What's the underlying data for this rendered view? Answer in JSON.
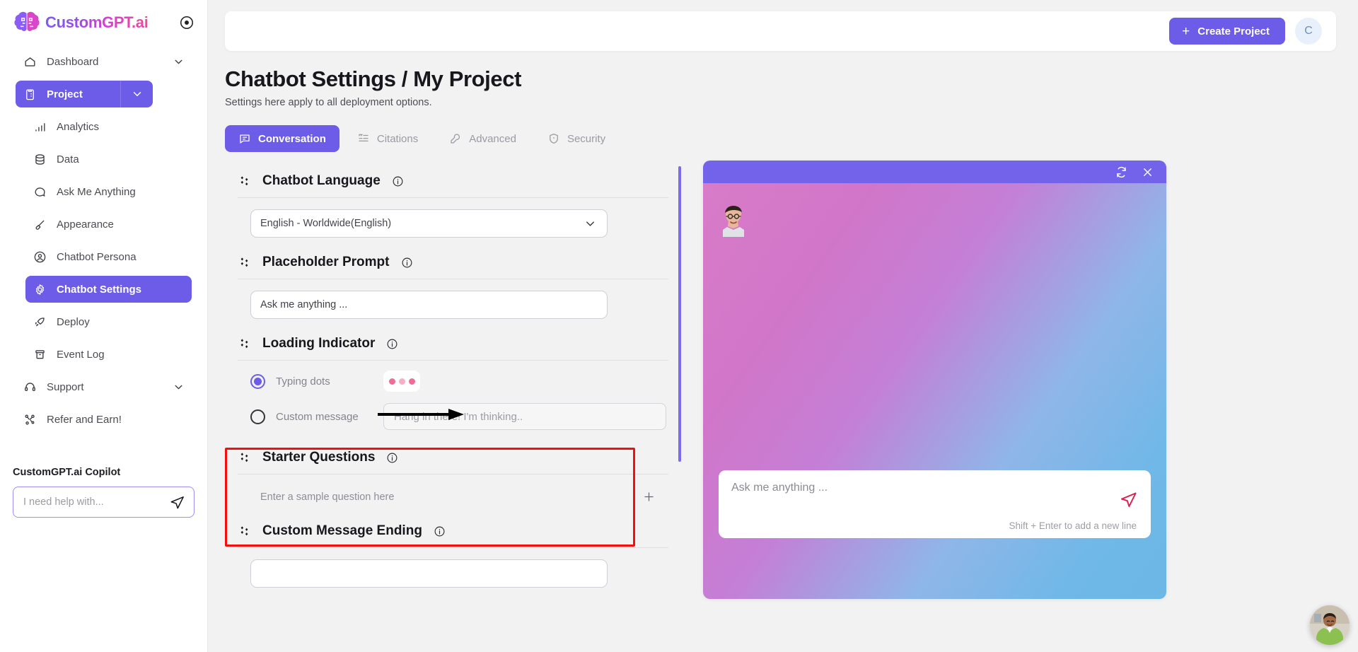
{
  "brand": {
    "name": "CustomGPT.ai",
    "target_icon": "target-icon"
  },
  "sidebar": {
    "items": [
      {
        "label": "Dashboard",
        "icon": "home-icon",
        "has_chevron": true
      },
      {
        "label": "Project",
        "icon": "clipboard-icon",
        "has_chevron": true,
        "active": true
      },
      {
        "label": "Analytics",
        "icon": "bar-chart-icon"
      },
      {
        "label": "Data",
        "icon": "database-icon"
      },
      {
        "label": "Ask Me Anything",
        "icon": "chat-bubble-icon"
      },
      {
        "label": "Appearance",
        "icon": "paintbrush-icon"
      },
      {
        "label": "Chatbot Persona",
        "icon": "user-circle-icon"
      },
      {
        "label": "Chatbot Settings",
        "icon": "gear-icon",
        "active": true
      },
      {
        "label": "Deploy",
        "icon": "rocket-icon"
      },
      {
        "label": "Event Log",
        "icon": "archive-icon"
      },
      {
        "label": "Support",
        "icon": "headset-icon",
        "has_chevron": true
      },
      {
        "label": "Refer and Earn!",
        "icon": "share-nodes-icon"
      }
    ],
    "copilot": {
      "title": "CustomGPT.ai Copilot",
      "placeholder": "I need help with...",
      "value": "",
      "send_icon": "send-icon"
    }
  },
  "topbar": {
    "create_label": "Create Project",
    "plus": "+",
    "avatar_initial": "C"
  },
  "page": {
    "title": "Chatbot Settings / My Project",
    "subtitle": "Settings here apply to all deployment options."
  },
  "tabs": [
    {
      "label": "Conversation",
      "icon": "message-square-icon",
      "active": true
    },
    {
      "label": "Citations",
      "icon": "quote-list-icon",
      "active": false
    },
    {
      "label": "Advanced",
      "icon": "wrench-icon",
      "active": false
    },
    {
      "label": "Security",
      "icon": "shield-check-icon",
      "active": false
    }
  ],
  "settings": {
    "language": {
      "title": "Chatbot Language",
      "info_icon": "info-icon",
      "drag_icon": "drag-handle-icon",
      "selected": "English - Worldwide(English)",
      "chevron_icon": "chevron-down-icon"
    },
    "placeholder_prompt": {
      "title": "Placeholder Prompt",
      "info_icon": "info-icon",
      "drag_icon": "drag-handle-icon",
      "value": "Ask me anything ..."
    },
    "loading_indicator": {
      "title": "Loading Indicator",
      "info_icon": "info-icon",
      "drag_icon": "drag-handle-icon",
      "highlight_color": "#f60e0e",
      "options": [
        {
          "label": "Typing dots",
          "selected": true
        },
        {
          "label": "Custom message",
          "selected": false
        }
      ],
      "custom_message_placeholder": "Hang in there! I'm thinking..",
      "custom_message_value": "",
      "dots_preview": {
        "colors": [
          "#ec6e96",
          "#f5afc6",
          "#ec6e96"
        ]
      }
    },
    "starter_questions": {
      "title": "Starter Questions",
      "info_icon": "info-icon",
      "drag_icon": "drag-handle-icon",
      "placeholder": "Enter a sample question here",
      "value": "",
      "add_icon": "plus-icon"
    },
    "custom_message_ending": {
      "title": "Custom Message Ending",
      "info_icon": "info-icon",
      "drag_icon": "drag-handle-icon",
      "value": ""
    }
  },
  "preview": {
    "refresh_icon": "refresh-icon",
    "close_icon": "close-icon",
    "bot_avatar": "bot-avatar-image",
    "input_placeholder": "Ask me anything ...",
    "hint": "Shift + Enter to add a new line",
    "send_icon": "send-icon"
  },
  "annotation": {
    "arrow_icon": "arrow-right-annotation",
    "arrow_color": "#000000"
  },
  "fab": {
    "icon": "support-agent-avatar"
  },
  "colors": {
    "accent": "#6c5ce7",
    "highlight": "#f60e0e",
    "page_bg": "#f2f2f3",
    "dot_pink": "#ec6e96"
  }
}
